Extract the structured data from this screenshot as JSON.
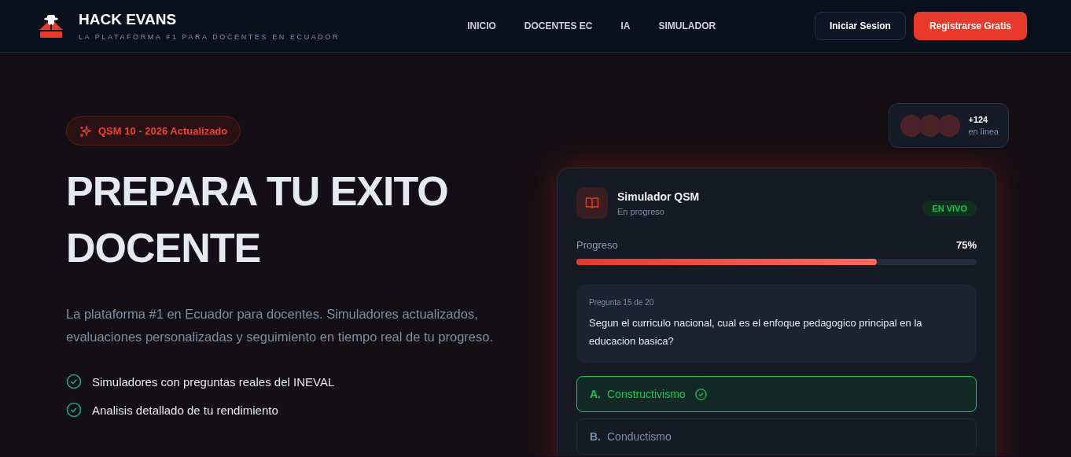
{
  "header": {
    "brand": "HACK EVANS",
    "tagline": "LA PLATAFORMA #1 PARA DOCENTES EN ECUADOR",
    "nav": [
      "INICIO",
      "DOCENTES EC",
      "IA",
      "SIMULADOR"
    ],
    "buttons": [
      {
        "label": "Iniciar Sesion",
        "kind": "secondary"
      },
      {
        "label": "Registrarse Gratis",
        "kind": "primary"
      }
    ]
  },
  "hero": {
    "badge": "QSM 10 - 2026 Actualizado",
    "title": "PREPARA TU EXITO DOCENTE",
    "description": "La plataforma #1 en Ecuador para docentes. Simuladores actualizados, evaluaciones personalizadas y seguimiento en tiempo real de tu progreso.",
    "features": [
      "Simuladores con preguntas reales del INEVAL",
      "Analisis detallado de tu rendimiento"
    ]
  },
  "simulator": {
    "title": "Simulador QSM",
    "subtitle": "En progreso",
    "status": "EN VIVO",
    "online": {
      "count": "+124",
      "label": "en linea"
    },
    "progress": {
      "label": "Progreso",
      "reading": "75%",
      "level": 0.75
    },
    "question": {
      "number": "Pregunta 15 de 20",
      "text": "Segun el curriculo nacional, cual es el enfoque pedagogico principal en la educacion basica?"
    },
    "options": [
      {
        "letter": "A.",
        "text": "Constructivismo",
        "selected": true
      },
      {
        "letter": "B.",
        "text": "Conductismo",
        "selected": false
      }
    ]
  }
}
